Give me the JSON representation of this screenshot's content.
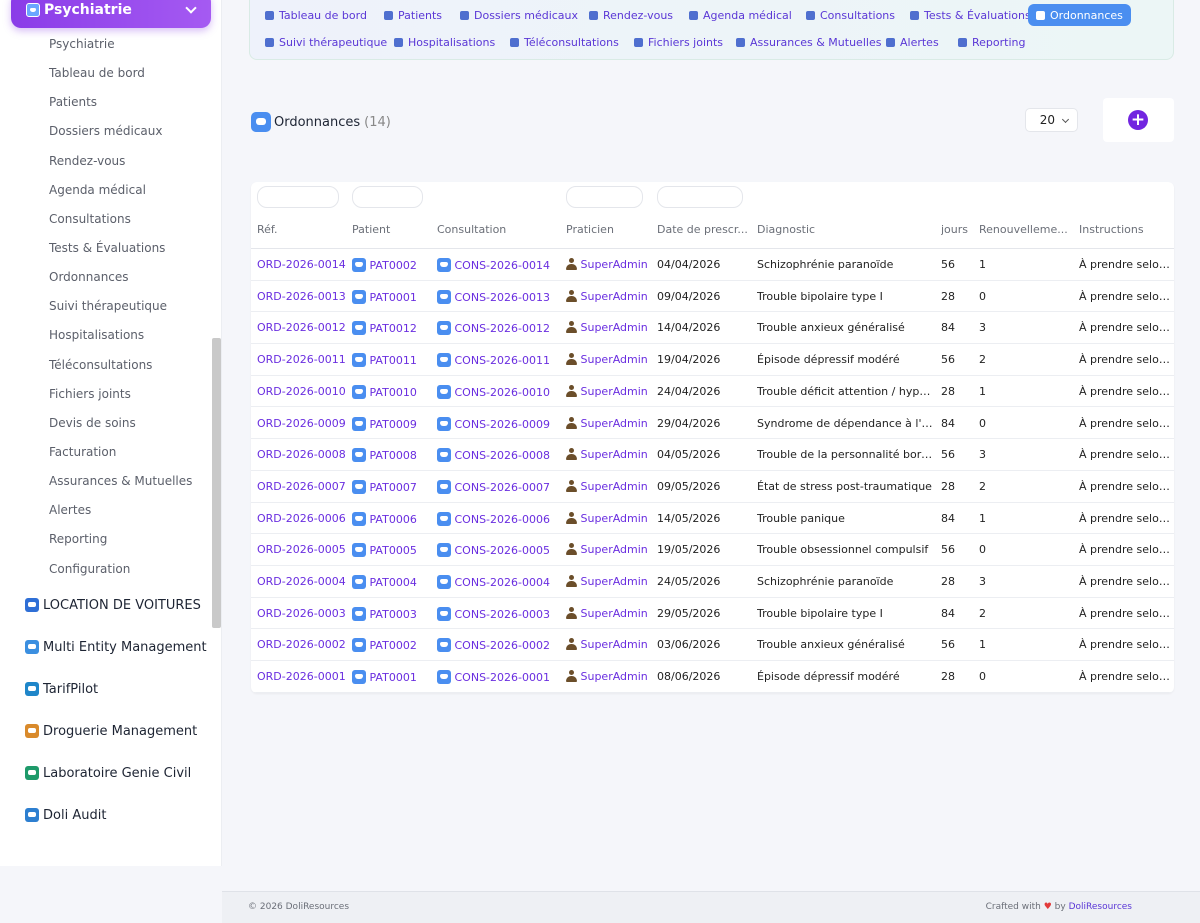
{
  "sidebar": {
    "module_title": "Psychiatrie",
    "submenu": [
      "Psychiatrie",
      "Tableau de bord",
      "Patients",
      "Dossiers médicaux",
      "Rendez-vous",
      "Agenda médical",
      "Consultations",
      "Tests & Évaluations",
      "Ordonnances",
      "Suivi thérapeutique",
      "Hospitalisations",
      "Téléconsultations",
      "Fichiers joints",
      "Devis de soins",
      "Facturation",
      "Assurances & Mutuelles",
      "Alertes",
      "Reporting",
      "Configuration"
    ],
    "modules": [
      {
        "label": "LOCATION DE VOITURES",
        "color": "#2f6fd6"
      },
      {
        "label": "Multi Entity Management",
        "color": "#3b8fe0"
      },
      {
        "label": "TarifPilot",
        "color": "#1f86c9"
      },
      {
        "label": "Droguerie Management",
        "color": "#d98a2b"
      },
      {
        "label": "Laboratoire Genie Civil",
        "color": "#1e9a6a"
      },
      {
        "label": "Doli Audit",
        "color": "#2d7fd0"
      }
    ]
  },
  "topnav": {
    "row1": [
      "Tableau de bord",
      "Patients",
      "Dossiers médicaux",
      "Rendez-vous",
      "Agenda médical",
      "Consultations",
      "Tests & Évaluations",
      "Ordonnances"
    ],
    "row2": [
      "Suivi thérapeutique",
      "Hospitalisations",
      "Téléconsultations",
      "Fichiers joints",
      "Assurances & Mutuelles",
      "Alertes",
      "Reporting"
    ],
    "active": "Ordonnances"
  },
  "page": {
    "title": "Ordonnances",
    "count": "(14)",
    "limit": "20"
  },
  "table": {
    "columns": [
      "Réf.",
      "Patient",
      "Consultation",
      "Praticien",
      "Date de prescr...",
      "Diagnostic",
      "jours",
      "Renouvelleme...",
      "Instructions"
    ],
    "rows": [
      [
        "ORD-2026-0014",
        "PAT0002",
        "CONS-2026-0014",
        "SuperAdmin",
        "04/04/2026",
        "Schizophrénie paranoïde",
        "56",
        "1",
        "À prendre selon la p"
      ],
      [
        "ORD-2026-0013",
        "PAT0001",
        "CONS-2026-0013",
        "SuperAdmin",
        "09/04/2026",
        "Trouble bipolaire type I",
        "28",
        "0",
        "À prendre selon la p"
      ],
      [
        "ORD-2026-0012",
        "PAT0012",
        "CONS-2026-0012",
        "SuperAdmin",
        "14/04/2026",
        "Trouble anxieux généralisé",
        "84",
        "3",
        "À prendre selon la p"
      ],
      [
        "ORD-2026-0011",
        "PAT0011",
        "CONS-2026-0011",
        "SuperAdmin",
        "19/04/2026",
        "Épisode dépressif modéré",
        "56",
        "2",
        "À prendre selon la p"
      ],
      [
        "ORD-2026-0010",
        "PAT0010",
        "CONS-2026-0010",
        "SuperAdmin",
        "24/04/2026",
        "Trouble déficit attention / hypera...",
        "28",
        "1",
        "À prendre selon la p"
      ],
      [
        "ORD-2026-0009",
        "PAT0009",
        "CONS-2026-0009",
        "SuperAdmin",
        "29/04/2026",
        "Syndrome de dépendance à l'al...",
        "84",
        "0",
        "À prendre selon la p"
      ],
      [
        "ORD-2026-0008",
        "PAT0008",
        "CONS-2026-0008",
        "SuperAdmin",
        "04/05/2026",
        "Trouble de la personnalité borde...",
        "56",
        "3",
        "À prendre selon la p"
      ],
      [
        "ORD-2026-0007",
        "PAT0007",
        "CONS-2026-0007",
        "SuperAdmin",
        "09/05/2026",
        "État de stress post-traumatique",
        "28",
        "2",
        "À prendre selon la p"
      ],
      [
        "ORD-2026-0006",
        "PAT0006",
        "CONS-2026-0006",
        "SuperAdmin",
        "14/05/2026",
        "Trouble panique",
        "84",
        "1",
        "À prendre selon la p"
      ],
      [
        "ORD-2026-0005",
        "PAT0005",
        "CONS-2026-0005",
        "SuperAdmin",
        "19/05/2026",
        "Trouble obsessionnel compulsif",
        "56",
        "0",
        "À prendre selon la p"
      ],
      [
        "ORD-2026-0004",
        "PAT0004",
        "CONS-2026-0004",
        "SuperAdmin",
        "24/05/2026",
        "Schizophrénie paranoïde",
        "28",
        "3",
        "À prendre selon la p"
      ],
      [
        "ORD-2026-0003",
        "PAT0003",
        "CONS-2026-0003",
        "SuperAdmin",
        "29/05/2026",
        "Trouble bipolaire type I",
        "84",
        "2",
        "À prendre selon la p"
      ],
      [
        "ORD-2026-0002",
        "PAT0002",
        "CONS-2026-0002",
        "SuperAdmin",
        "03/06/2026",
        "Trouble anxieux généralisé",
        "56",
        "1",
        "À prendre selon la p"
      ],
      [
        "ORD-2026-0001",
        "PAT0001",
        "CONS-2026-0001",
        "SuperAdmin",
        "08/06/2026",
        "Épisode dépressif modéré",
        "28",
        "0",
        "À prendre selon la p"
      ]
    ]
  },
  "footer": {
    "copyright": "© 2026 DoliResources",
    "crafted": "Crafted with",
    "by": "by",
    "brand": "DoliResources"
  }
}
